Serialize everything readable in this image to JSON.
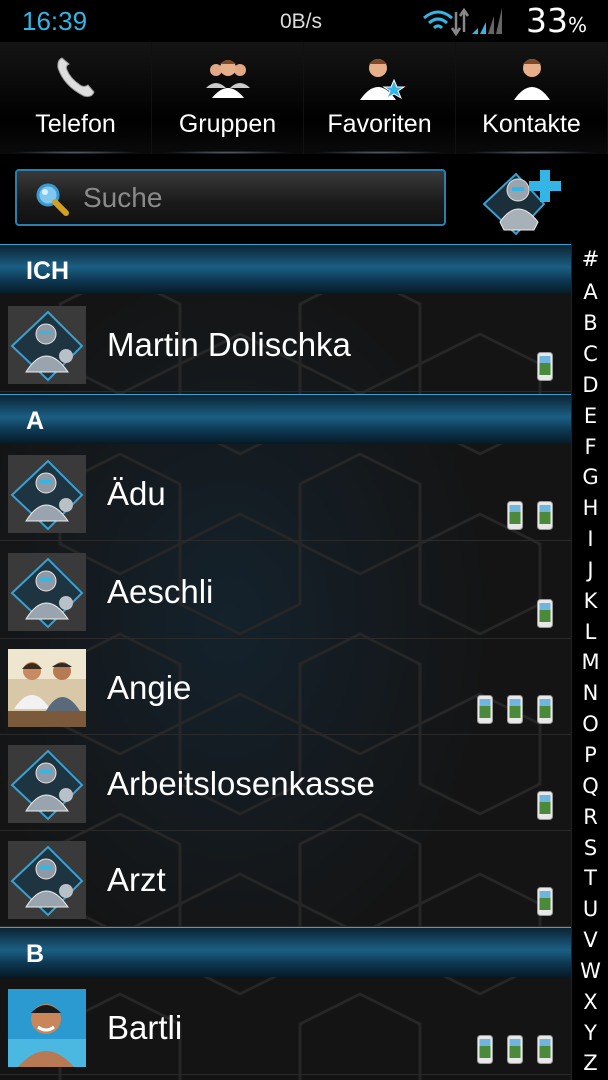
{
  "status_bar": {
    "time": "16:39",
    "network_rate": "0B/s",
    "battery_value": "33",
    "battery_unit": "%"
  },
  "tabs": [
    {
      "label": "Telefon",
      "icon": "phone-handset-icon"
    },
    {
      "label": "Gruppen",
      "icon": "group-people-icon"
    },
    {
      "label": "Favoriten",
      "icon": "favorite-person-icon"
    },
    {
      "label": "Kontakte",
      "icon": "contact-person-icon"
    }
  ],
  "search": {
    "placeholder": "Suche",
    "value": ""
  },
  "add_contact": {
    "icon": "add-contact-icon"
  },
  "sections": [
    {
      "label": "ICH"
    },
    {
      "label": "A"
    },
    {
      "label": "B"
    }
  ],
  "contacts": [
    {
      "name": "Martin Dolischka",
      "section": "ICH",
      "avatar": "robot-avatar",
      "phone_count": 1
    },
    {
      "name": "Ädu",
      "section": "A",
      "avatar": "robot-avatar",
      "phone_count": 2
    },
    {
      "name": "Aeschli",
      "section": "A",
      "avatar": "robot-avatar",
      "phone_count": 1
    },
    {
      "name": "Angie",
      "section": "A",
      "avatar": "photo-avatar",
      "phone_count": 3
    },
    {
      "name": "Arbeitslosenkasse",
      "section": "A",
      "avatar": "robot-avatar",
      "phone_count": 1
    },
    {
      "name": "Arzt",
      "section": "A",
      "avatar": "robot-avatar",
      "phone_count": 1
    },
    {
      "name": "Bartli",
      "section": "B",
      "avatar": "photo-avatar",
      "phone_count": 3
    }
  ],
  "alphabet_index": [
    "#",
    "A",
    "B",
    "C",
    "D",
    "E",
    "F",
    "G",
    "H",
    "I",
    "J",
    "K",
    "L",
    "M",
    "N",
    "O",
    "P",
    "Q",
    "R",
    "S",
    "T",
    "U",
    "V",
    "W",
    "X",
    "Y",
    "Z"
  ],
  "colors": {
    "accent": "#33b5e5",
    "section_blue": "#1b5f83",
    "background": "#141414"
  }
}
